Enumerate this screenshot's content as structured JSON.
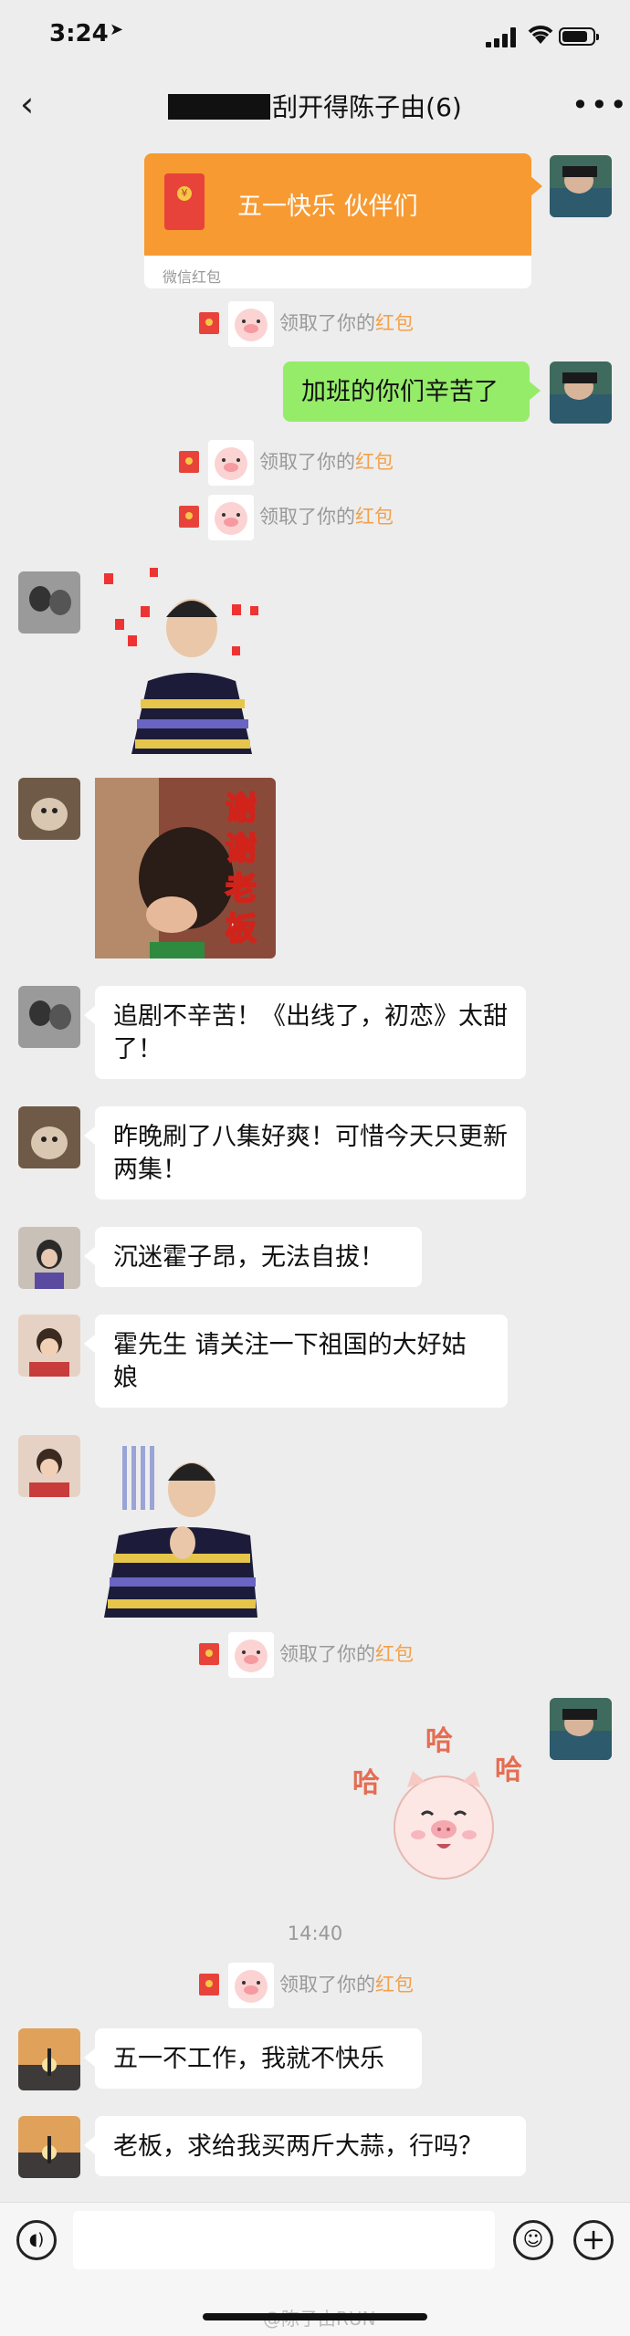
{
  "status": {
    "time": "3:24",
    "battery_level": 0.85
  },
  "nav": {
    "title": "刮开得陈子由(6)",
    "back_icon": "chevron-left-icon",
    "more_icon": "more-dots-icon"
  },
  "messages": {
    "red_packet": {
      "greeting": "五一快乐 伙伴们",
      "footer": "微信红包"
    },
    "notice": {
      "text": "领取了你的",
      "highlight": "红包"
    },
    "self_text_1": "加班的你们辛苦了",
    "text_1": "追剧不辛苦！《出线了，初恋》太甜了！",
    "text_2": "昨晚刷了八集好爽！可惜今天只更新两集！",
    "text_3": "沉迷霍子昂，无法自拔！",
    "text_4": "霍先生 请关注一下祖国的大好姑娘",
    "sticker_thanks": "谢谢老板",
    "sticker_ha": "哈",
    "timestamp": "14:40",
    "text_5": "五一不工作，我就不快乐",
    "text_6": "老板，求给我买两斤大蒜，行吗？"
  },
  "watermark": "@陈子由RUN",
  "colors": {
    "self_bubble": "#95ec69",
    "red_packet": "#f79a32",
    "highlight": "#f3a14a",
    "background": "#ededed"
  }
}
